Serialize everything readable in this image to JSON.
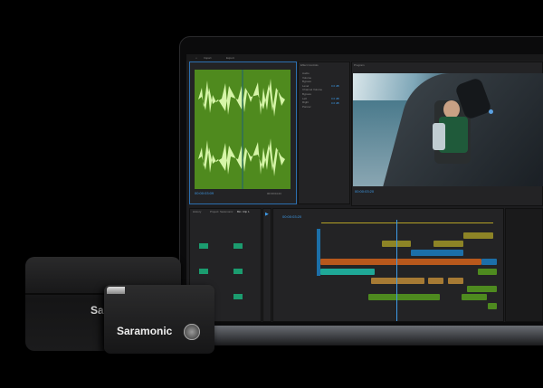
{
  "brand": {
    "device_logo": "Saramonic",
    "case_logo": "Saramonic"
  },
  "editor": {
    "top_tabs": [
      "Import",
      "Export"
    ],
    "source_panel": {
      "timecode_in": "00:00:03:09",
      "timecode_out": "00:00:04:23"
    },
    "effect_controls": {
      "title": "Effect Controls",
      "items": [
        "Audio",
        "Volume",
        "Bypass",
        "Level",
        "Channel Volume",
        "Bypass",
        "Left",
        "Right",
        "Panner"
      ],
      "values": [
        "0.0 dB",
        "0.0 dB",
        "0.0 dB"
      ]
    },
    "program_panel": {
      "title": "Program",
      "timecode": "00:00:03:20"
    },
    "timeline": {
      "timecode": "00:00:03:20"
    },
    "project_panel": {
      "tabs": [
        "History",
        "Project: Saramonic",
        "Bin: Clip 1"
      ]
    }
  },
  "colors": {
    "waveform_bg": "#4f8a1e",
    "waveform": "#d6f5a8",
    "orange": "#b8581c",
    "olive": "#8d8426",
    "teal": "#1fa897",
    "green": "#4e8a1f",
    "blue": "#1c6fa8",
    "tan": "#a67a34"
  }
}
